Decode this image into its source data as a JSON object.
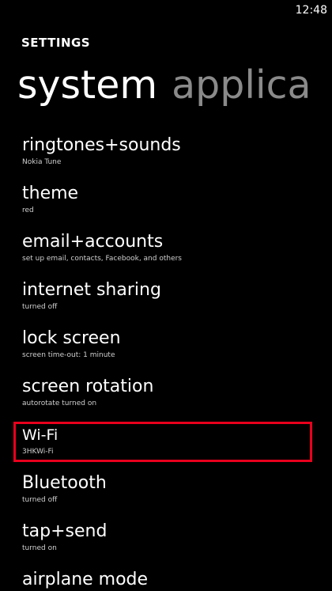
{
  "status_bar": {
    "time": "12:48"
  },
  "header": {
    "app_title": "SETTINGS",
    "pivot_current": "system",
    "pivot_next": "applica"
  },
  "settings": {
    "items": [
      {
        "label": "ringtones+sounds",
        "sub": "Nokia Tune"
      },
      {
        "label": "theme",
        "sub": "red"
      },
      {
        "label": "email+accounts",
        "sub": "set up email, contacts, Facebook, and others"
      },
      {
        "label": "internet sharing",
        "sub": "turned off"
      },
      {
        "label": "lock screen",
        "sub": "screen time-out: 1 minute"
      },
      {
        "label": "screen rotation",
        "sub": "autorotate turned on"
      },
      {
        "label": "Wi-Fi",
        "sub": "3HKWi-Fi"
      },
      {
        "label": "Bluetooth",
        "sub": "turned off"
      },
      {
        "label": "tap+send",
        "sub": "turned on"
      },
      {
        "label": "airplane mode",
        "sub": ""
      }
    ]
  },
  "colors": {
    "background": "#000000",
    "highlight_border": "#e8001c",
    "pivot_inactive": "#8a8a8a"
  }
}
